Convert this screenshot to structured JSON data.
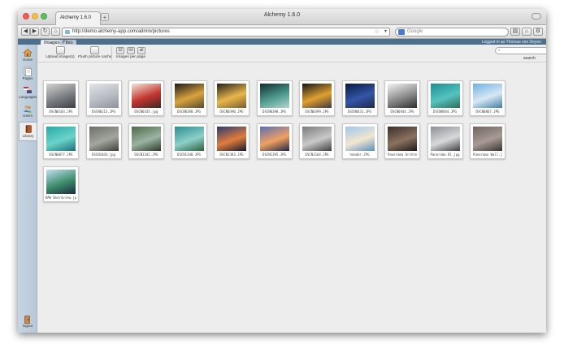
{
  "window": {
    "title": "Alchemy 1.6.0",
    "tab_label": "Alchemy 1.6.0",
    "new_tab": "+"
  },
  "toolbar": {
    "back": "◀",
    "forward": "▶",
    "reload": "↻",
    "home": "⌂",
    "url": "http://demo.alchemy-app.com/admin/pictures",
    "bookmark_star": "☆",
    "url_dropdown": "▾",
    "search_placeholder": "Google"
  },
  "app_header": {
    "tabs": [
      "Images",
      "Files"
    ],
    "logged_in": "Logged in as Thomas von Deyen"
  },
  "sidebar": {
    "items": [
      {
        "label": "Home",
        "icon": "home-icon"
      },
      {
        "label": "Pages",
        "icon": "pages-icon"
      },
      {
        "label": "Languages",
        "icon": "languages-icon"
      },
      {
        "label": "Users",
        "icon": "users-icon"
      },
      {
        "label": "Library",
        "icon": "library-icon"
      }
    ],
    "logout_label": "logout"
  },
  "subtoolbar": {
    "upload_label": "Upload image(s)",
    "flush_label": "Flush picture cache",
    "per_page_options": [
      "32",
      "64",
      "all"
    ],
    "per_page_label": "Images per page",
    "search_label": "search",
    "search_placeholder": "⌕"
  },
  "pictures": [
    {
      "name": "DSCN0103.JPG",
      "colors": [
        "#d6d3cf",
        "#7b7f85",
        "#3c3e42"
      ]
    },
    {
      "name": "DSCN0113.JPG",
      "colors": [
        "#e2e4e8",
        "#b8bcc3",
        "#8d929b"
      ]
    },
    {
      "name": "DSCN0335.jpg",
      "colors": [
        "#f1e6d6",
        "#c2342f",
        "#3b2a26"
      ]
    },
    {
      "name": "DSCN0388.JPG",
      "colors": [
        "#1b1a18",
        "#d9a33d",
        "#5a4a2c"
      ]
    },
    {
      "name": "DSCN0390.JPG",
      "colors": [
        "#24201b",
        "#e8b64a",
        "#7a5d30"
      ]
    },
    {
      "name": "DSCN0398.JPG",
      "colors": [
        "#0f2d2e",
        "#4f9a8f",
        "#b4d6cf"
      ]
    },
    {
      "name": "DSCN0399.JPG",
      "colors": [
        "#151518",
        "#e0a030",
        "#403a3d"
      ]
    },
    {
      "name": "DSCN0431.JPG",
      "colors": [
        "#0a1a3e",
        "#3456a8",
        "#1e2a4a"
      ]
    },
    {
      "name": "DSCN0444.JPG",
      "colors": [
        "#f4f4f4",
        "#8a8a8a",
        "#2d2d2d"
      ]
    },
    {
      "name": "DSCN0844.JPG",
      "colors": [
        "#1e8d92",
        "#55c4bf",
        "#2f6e56"
      ]
    },
    {
      "name": "DSCN0867.JPG",
      "colors": [
        "#6fb0e2",
        "#d8e8f2",
        "#3f7ea7"
      ]
    },
    {
      "name": "DSCN0877.JPG",
      "colors": [
        "#2aa9a7",
        "#6ad3c9",
        "#1c6f78"
      ]
    },
    {
      "name": "DSCN1043.jpg",
      "colors": [
        "#6b6f68",
        "#a2a69e",
        "#3d403b"
      ]
    },
    {
      "name": "DSCN1342.JPG",
      "colors": [
        "#4f6a4a",
        "#9bb3a2",
        "#2d3b2b"
      ]
    },
    {
      "name": "DSCN1348.JPG",
      "colors": [
        "#2b8d92",
        "#8cd0c8",
        "#2f5f3e"
      ]
    },
    {
      "name": "DSCN1383.JPG",
      "colors": [
        "#2c3a6e",
        "#e07d3c",
        "#15182e"
      ]
    },
    {
      "name": "DSCN1395.JPG",
      "colors": [
        "#5b6fb3",
        "#f0a060",
        "#1e2648"
      ]
    },
    {
      "name": "DSCN1164.JPG",
      "colors": [
        "#7b7b7b",
        "#c9c9c9",
        "#3f3f3f"
      ]
    },
    {
      "name": "header.JPG",
      "colors": [
        "#9fc7ee",
        "#f2e6cf",
        "#5a8fbf"
      ]
    },
    {
      "name": "Panorama Archte",
      "colors": [
        "#3a2f2a",
        "#8a7260",
        "#201a17"
      ]
    },
    {
      "name": "Panorama Bl.jpg",
      "colors": [
        "#8c8f94",
        "#d8d9db",
        "#3d3f43"
      ]
    },
    {
      "name": "Panorama Wall.j",
      "colors": [
        "#6e6461",
        "#a89a94",
        "#3b3332"
      ]
    },
    {
      "name": "RAW Boardview.jp",
      "colors": [
        "#bfe0f2",
        "#3e8d6c",
        "#1b2c3e"
      ]
    }
  ]
}
